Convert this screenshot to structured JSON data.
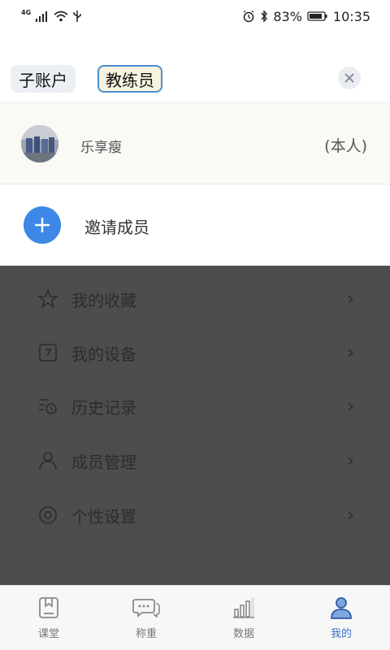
{
  "status_bar": {
    "network": "4G",
    "battery": "83%",
    "time": "10:35"
  },
  "tabs": [
    {
      "label": "子账户"
    },
    {
      "label": "教练员"
    }
  ],
  "close": {
    "icon": "close-icon"
  },
  "member": {
    "name": "乐享瘦",
    "tag": "(本人)"
  },
  "invite": {
    "label": "邀请成员",
    "icon": "plus-icon"
  },
  "menu": {
    "items": [
      {
        "label": "我的收藏",
        "icon": "star-icon"
      },
      {
        "label": "我的设备",
        "icon": "device-icon"
      },
      {
        "label": "历史记录",
        "icon": "history-icon"
      },
      {
        "label": "成员管理",
        "icon": "members-icon"
      },
      {
        "label": "个性设置",
        "icon": "settings-icon"
      }
    ]
  },
  "nav": {
    "items": [
      {
        "label": "课堂",
        "icon": "classroom-icon"
      },
      {
        "label": "称重",
        "icon": "weigh-chat-icon"
      },
      {
        "label": "数据",
        "icon": "bar-chart-icon"
      },
      {
        "label": "我的",
        "icon": "profile-icon"
      }
    ],
    "active_index": 3
  },
  "colors": {
    "accent": "#3d87e6",
    "overlay": "#4d4d4d",
    "active_tab_border": "#4c8ed1"
  }
}
